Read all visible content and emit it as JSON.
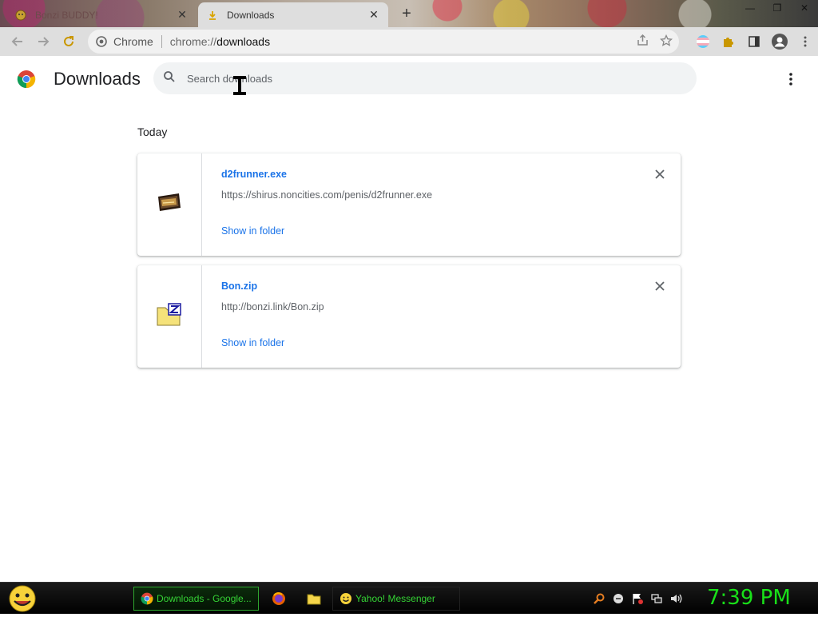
{
  "tabs": [
    {
      "title": "Bonzi BUDDY!",
      "active": false
    },
    {
      "title": "Downloads",
      "active": true
    }
  ],
  "toolbar": {
    "site_chip": "Chrome",
    "url_scheme": "chrome://",
    "url_host": "downloads"
  },
  "page": {
    "title": "Downloads",
    "search_placeholder": "Search downloads",
    "section_date": "Today"
  },
  "downloads": [
    {
      "file_name": "d2frunner.exe",
      "url": "https://shirus.noncities.com/penis/d2frunner.exe",
      "action": "Show in folder",
      "icon": "executable-file-icon"
    },
    {
      "file_name": "Bon.zip",
      "url": "http://bonzi.link/Bon.zip",
      "action": "Show in folder",
      "icon": "zip-archive-icon"
    }
  ],
  "taskbar": {
    "tasks": [
      {
        "label": "Downloads - Google...",
        "icon": "chrome-icon"
      },
      {
        "label": "Yahoo! Messenger",
        "icon": "yahoo-messenger-icon"
      }
    ],
    "clock": "7:39 PM"
  },
  "colors": {
    "link": "#1a73e8",
    "clock": "#19e019",
    "taskbar_text": "#35d435"
  }
}
